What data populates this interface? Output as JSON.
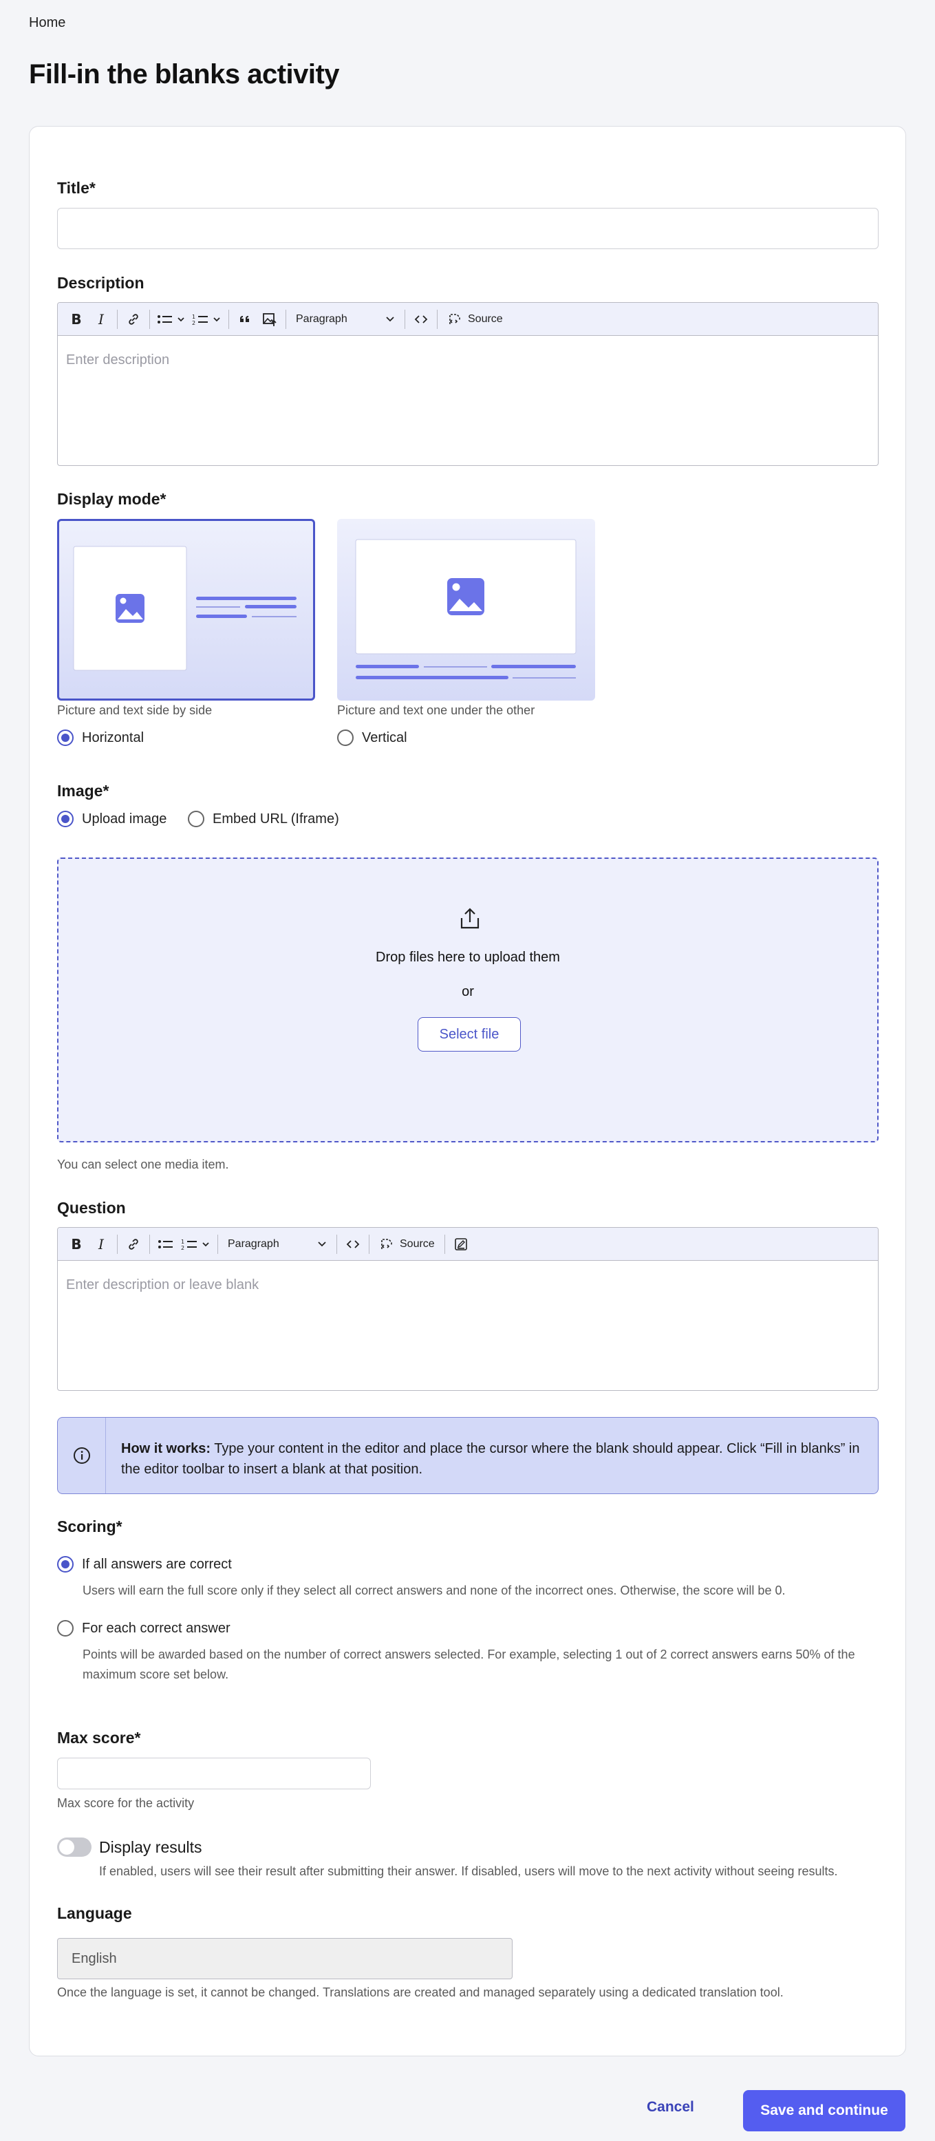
{
  "breadcrumb": {
    "home": "Home"
  },
  "page": {
    "title": "Fill-in the blanks activity"
  },
  "form": {
    "title": {
      "label": "Title*",
      "value": ""
    },
    "description": {
      "label": "Description",
      "placeholder": "Enter description"
    },
    "toolbar": {
      "paragraph": "Paragraph",
      "source": "Source"
    },
    "display_mode": {
      "label": "Display mode*",
      "horizontal": {
        "caption": "Picture and text side by side",
        "option": "Horizontal",
        "selected": true
      },
      "vertical": {
        "caption": "Picture and text one under the other",
        "option": "Vertical",
        "selected": false
      }
    },
    "image": {
      "label": "Image*",
      "upload_option": "Upload image",
      "embed_option": "Embed URL (Iframe)",
      "drop_text": "Drop files here to upload them",
      "or": "or",
      "select_file": "Select file",
      "help": "You can select one media item."
    },
    "question": {
      "label": "Question",
      "placeholder": "Enter description or leave blank"
    },
    "info": {
      "bold": "How it works:",
      "text": " Type your content in the editor and place the cursor where the blank should appear. Click “Fill in blanks” in the editor toolbar to insert a blank at that position."
    },
    "scoring": {
      "label": "Scoring*",
      "all_correct": {
        "option": "If all answers are correct",
        "help": "Users will earn the full score only if they select all correct answers and none of the incorrect ones. Otherwise, the score will be 0."
      },
      "each_correct": {
        "option": "For each correct answer",
        "help": "Points will be awarded based on the number of correct answers selected. For example, selecting 1 out of 2 correct answers earns 50% of the maximum score set below."
      }
    },
    "max_score": {
      "label": "Max score*",
      "value": "",
      "help": "Max score for the activity"
    },
    "display_results": {
      "label": "Display results",
      "enabled": false,
      "help": "If enabled, users will see their result after submitting their answer. If disabled, users will move to the next activity without seeing results."
    },
    "language": {
      "label": "Language",
      "value": "English",
      "help": "Once the language is set, it cannot be changed. Translations are created and managed separately using a dedicated translation tool."
    }
  },
  "actions": {
    "cancel": "Cancel",
    "save": "Save and continue"
  },
  "colors": {
    "accent": "#545df0",
    "accent_dark": "#4a55c9",
    "info_bg": "#d3d9f8"
  }
}
